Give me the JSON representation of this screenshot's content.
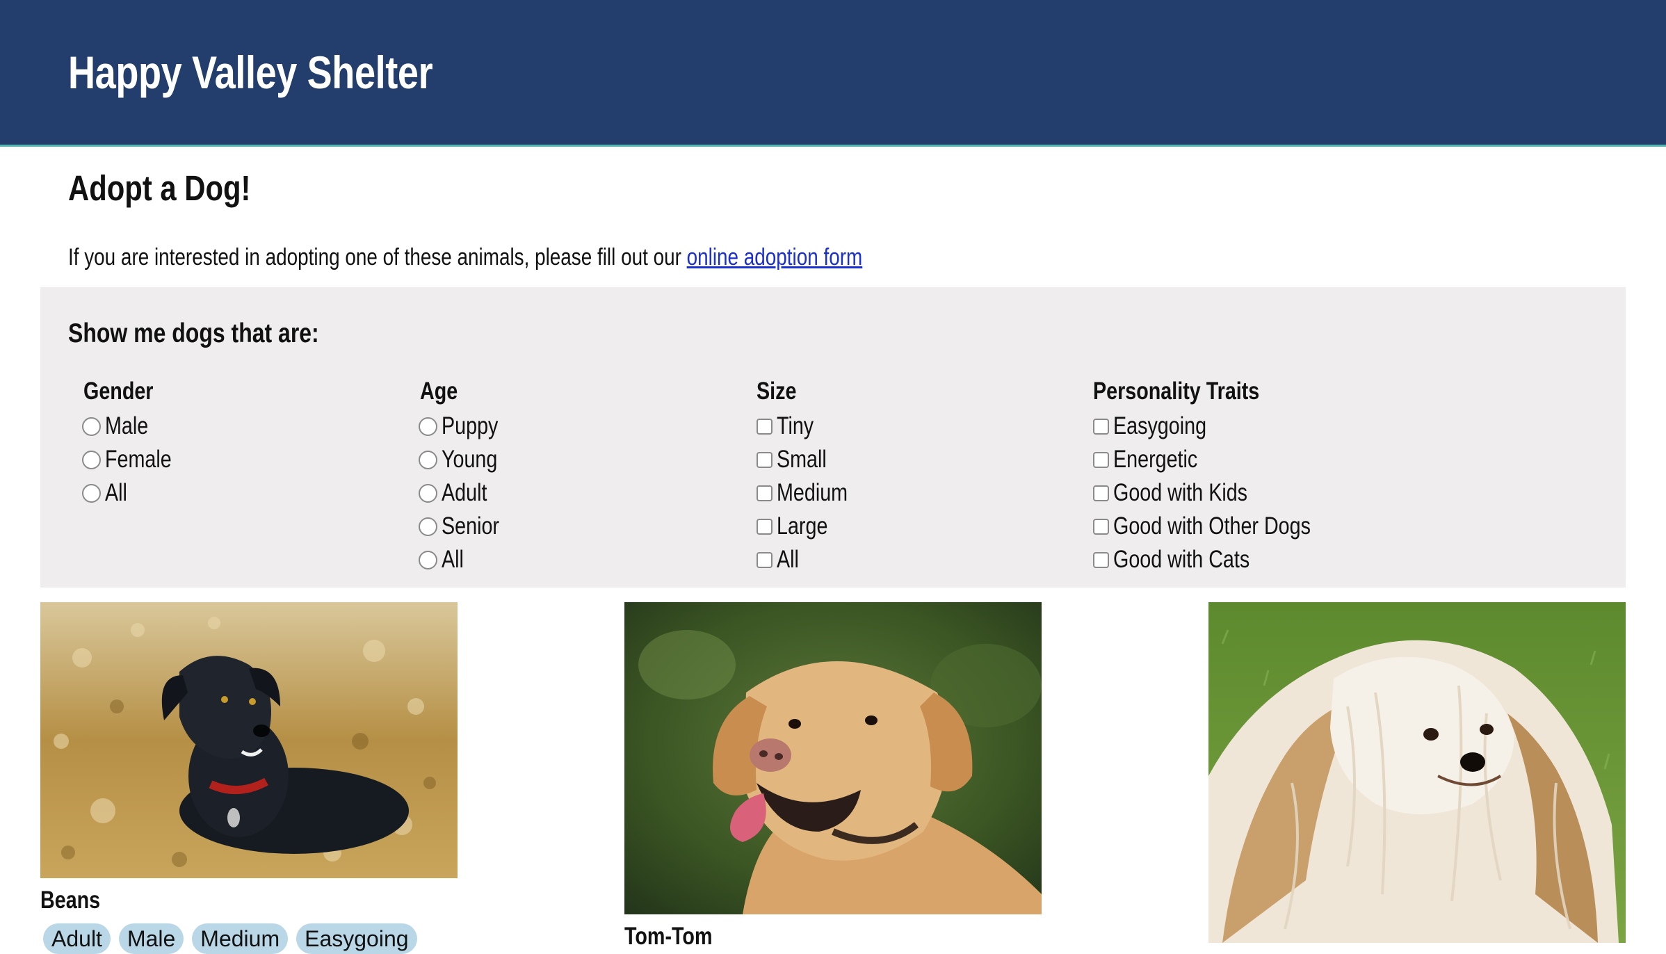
{
  "header": {
    "title": "Happy Valley Shelter",
    "background_color": "#233d6d",
    "accent_border_color": "#4fb8b0"
  },
  "main": {
    "heading": "Adopt a Dog!",
    "intro_text": "If you are interested in adopting one of these animals, please fill out our ",
    "intro_link": "online adoption form",
    "link_color": "#1a2fd0"
  },
  "filters": {
    "heading": "Show me dogs that are:",
    "panel_color": "#efedee",
    "gender": {
      "title": "Gender",
      "control": "radio",
      "options": [
        "Male",
        "Female",
        "All"
      ]
    },
    "age": {
      "title": "Age",
      "control": "radio",
      "options": [
        "Puppy",
        "Young",
        "Adult",
        "Senior",
        "All"
      ]
    },
    "size": {
      "title": "Size",
      "control": "checkbox",
      "options": [
        "Tiny",
        "Small",
        "Medium",
        "Large",
        "All"
      ]
    },
    "personality": {
      "title": "Personality Traits",
      "control": "checkbox",
      "options": [
        "Easygoing",
        "Energetic",
        "Good with Kids",
        "Good with Other Dogs",
        "Good with Cats"
      ]
    }
  },
  "dogs": [
    {
      "name": "Beans",
      "tags": [
        "Adult",
        "Male",
        "Medium",
        "Easygoing"
      ],
      "photo_icon": "dog-photo-black-terrier",
      "tag_color": "#b9d7e6"
    },
    {
      "name": "Tom-Tom",
      "tags": [],
      "photo_icon": "dog-photo-golden-labrador"
    },
    {
      "name": "",
      "tags": [],
      "photo_icon": "dog-photo-shih-tzu"
    }
  ]
}
